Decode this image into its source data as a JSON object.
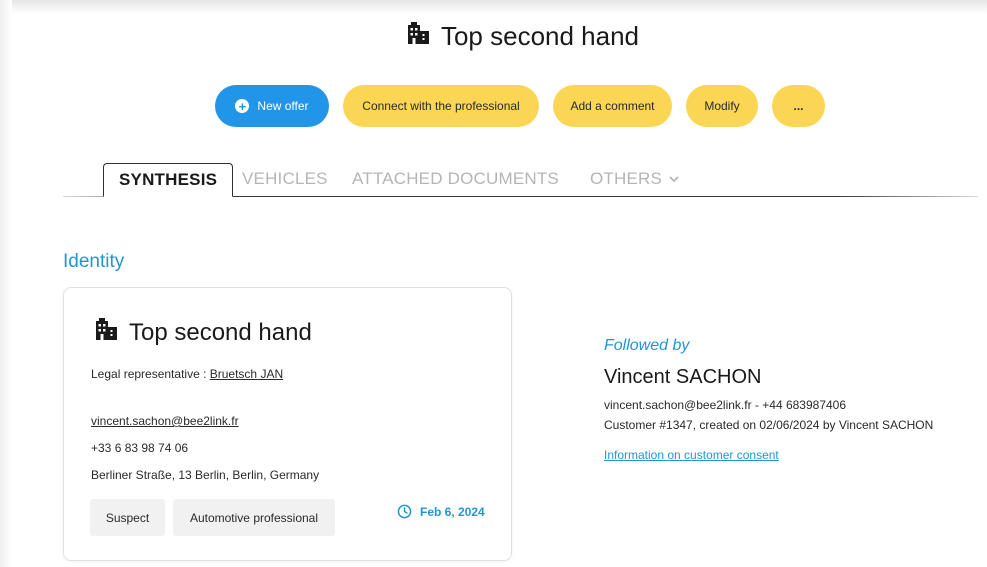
{
  "header": {
    "icon": "building-icon",
    "title": "Top second hand"
  },
  "actions": {
    "new_offer": "New offer",
    "connect": "Connect with the professional",
    "add_comment": "Add a comment",
    "modify": "Modify",
    "more": "...",
    "colors": {
      "blue": "#2196e8",
      "yellow": "#fbd654"
    }
  },
  "tabs": [
    {
      "label": "SYNTHESIS",
      "active": true
    },
    {
      "label": "VEHICLES",
      "active": false
    },
    {
      "label": "ATTACHED DOCUMENTS",
      "active": false
    },
    {
      "label": "OTHERS",
      "active": false,
      "icon": "chevron-down-icon"
    }
  ],
  "identity": {
    "section_title": "Identity",
    "card": {
      "name": "Top second hand",
      "legal_rep_label": "Legal representative :",
      "legal_rep_name": "Bruetsch JAN",
      "email": "vincent.sachon@bee2link.fr",
      "phone": "+33 6 83 98 74 06",
      "address": "Berliner Straße, 13 Berlin, Berlin, Germany",
      "tags": [
        "Suspect",
        "Automotive professional"
      ],
      "date": "Feb 6, 2024",
      "date_icon": "clock-icon"
    }
  },
  "followed_by": {
    "label": "Followed by",
    "name": "Vincent SACHON",
    "contact": "vincent.sachon@bee2link.fr - +44 683987406",
    "customer_info": "Customer #1347, created on 02/06/2024 by Vincent SACHON",
    "consent_link": "Information on customer consent"
  }
}
